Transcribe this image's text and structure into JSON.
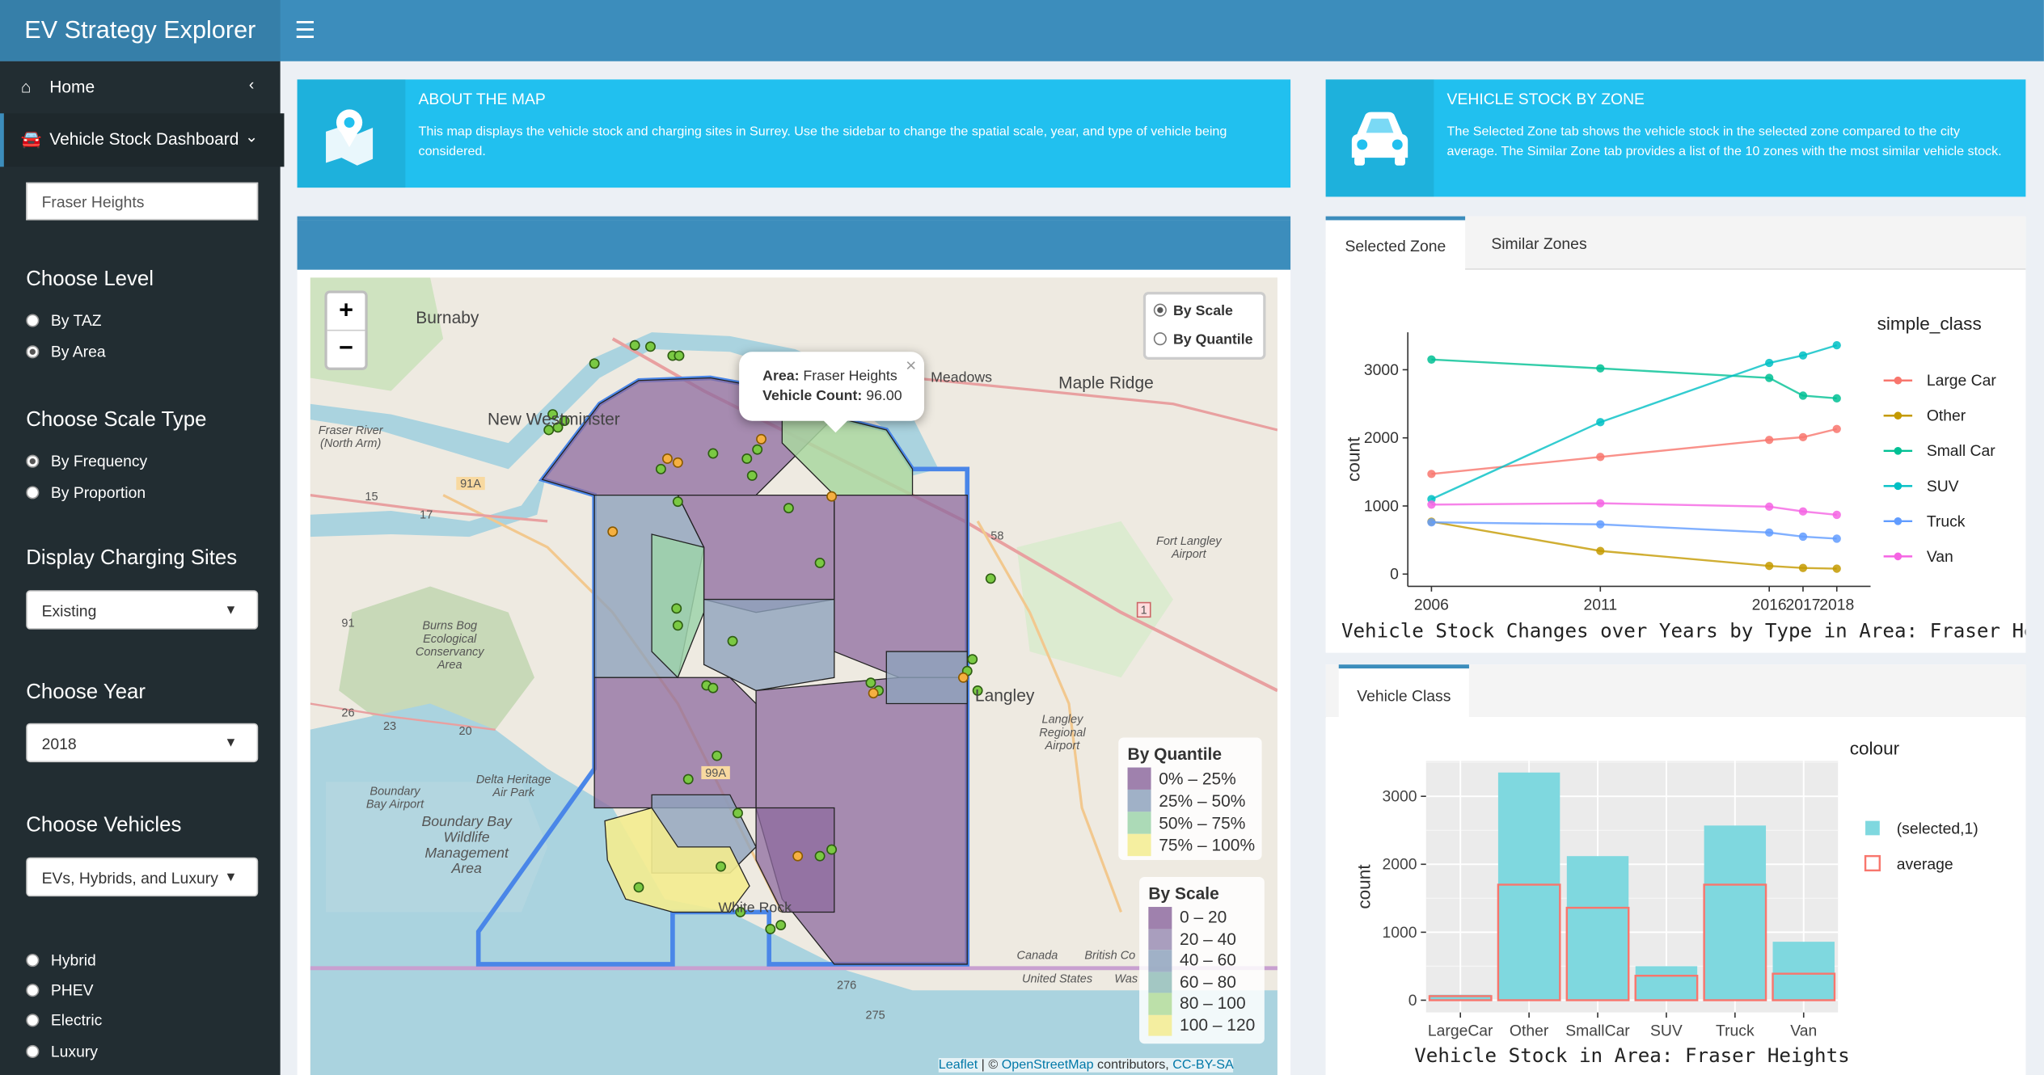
{
  "app": {
    "title": "EV Strategy Explorer"
  },
  "sidebar": {
    "menu": [
      {
        "label": "Home",
        "icon": "home-icon"
      },
      {
        "label": "Vehicle Stock Dashboard",
        "icon": "car-icon"
      }
    ],
    "area_input": "Fraser Heights",
    "level": {
      "heading": "Choose Level",
      "options": [
        "By TAZ",
        "By Area"
      ],
      "selected": "By Area"
    },
    "scale_type": {
      "heading": "Choose Scale Type",
      "options": [
        "By Frequency",
        "By Proportion"
      ],
      "selected": "By Frequency"
    },
    "charging": {
      "heading": "Display Charging Sites",
      "value": "Existing"
    },
    "year": {
      "heading": "Choose Year",
      "value": "2018"
    },
    "vehicles": {
      "heading": "Choose Vehicles",
      "value": "EVs, Hybrids, and Luxury",
      "options": [
        "Hybrid",
        "PHEV",
        "Electric",
        "Luxury"
      ]
    }
  },
  "about": {
    "title": "ABOUT THE MAP",
    "text": "This map displays the vehicle stock and charging sites in Surrey. Use the sidebar to change the spatial scale, year, and type of vehicle being considered."
  },
  "stock_info": {
    "title": "VEHICLE STOCK BY ZONE",
    "text": "The Selected Zone tab shows the vehicle stock in the selected zone compared to the city average. The Similar Zone tab provides a list of the 10 zones with the most similar vehicle stock."
  },
  "map": {
    "zoom_in": "+",
    "zoom_out": "−",
    "scale_options": [
      "By Scale",
      "By Quantile"
    ],
    "scale_selected": "By Scale",
    "popup": {
      "area_label": "Area:",
      "area_value": "Fraser Heights",
      "count_label": "Vehicle Count:",
      "count_value": "96.00",
      "close": "×"
    },
    "place_labels": [
      "Burnaby",
      "New Westminster",
      "Maple Ridge",
      "Meadows",
      "Langley",
      "White Rock",
      "Fort Langley Airport",
      "Burns Bog Ecological Conservancy Area",
      "Boundary Bay Wildlife Management Area",
      "Delta Heritage Air Park",
      "Boundary Bay Airport",
      "Langley Regional Airport",
      "Canada",
      "United States",
      "British Co",
      "Was",
      "Fraser River (North Arm)"
    ],
    "road_labels": [
      "91A",
      "99A",
      "15",
      "17",
      "91",
      "1",
      "58",
      "276",
      "275",
      "20",
      "23",
      "26"
    ],
    "legend_quantile": {
      "title": "By Quantile",
      "items": [
        "0% – 25%",
        "25% – 50%",
        "50% – 75%",
        "75% – 100%"
      ],
      "colors": [
        "#8e6b9f",
        "#8fa3bd",
        "#9dd3aa",
        "#f3ec8f"
      ]
    },
    "legend_scale": {
      "title": "By Scale",
      "items": [
        "0 – 20",
        "20 – 40",
        "40 – 60",
        "60 – 80",
        "80 – 100",
        "100 – 120"
      ],
      "colors": [
        "#8e6b9f",
        "#9a8db3",
        "#8fa3bd",
        "#93bdb8",
        "#b3dc9a",
        "#f5ec8f"
      ]
    },
    "attribution": {
      "leaflet": "Leaflet",
      "sep": " | © ",
      "osm": "OpenStreetMap",
      "mid": " contributors, ",
      "license": "CC-BY-SA"
    }
  },
  "tabs_top": {
    "items": [
      "Selected Zone",
      "Similar Zones"
    ],
    "active": "Selected Zone"
  },
  "tabs_bottom": {
    "items": [
      "Vehicle Class"
    ],
    "active": "Vehicle Class"
  },
  "line_chart": {
    "chart_data": {
      "type": "line",
      "title": "Vehicle Stock Changes over Years by Type in Area: Fraser Heights",
      "xlabel": "",
      "ylabel": "count",
      "legend_title": "simple_class",
      "x": [
        2006,
        2011,
        2016,
        2017,
        2018
      ],
      "x_tick_labels": [
        "2006",
        "2011",
        "2016",
        "2017",
        "2018"
      ],
      "ylim": [
        0,
        3500
      ],
      "y_ticks": [
        0,
        1000,
        2000,
        3000
      ],
      "series": [
        {
          "name": "Large Car",
          "color": "#f8766d",
          "values": [
            1470,
            1720,
            1970,
            2010,
            2130
          ]
        },
        {
          "name": "Other",
          "color": "#c49a00",
          "values": [
            770,
            340,
            120,
            90,
            80
          ]
        },
        {
          "name": "Small Car",
          "color": "#53b400",
          "values": [
            3150,
            3020,
            2880,
            2620,
            2580
          ]
        },
        {
          "name": "SUV",
          "color": "#00c094",
          "values": [
            1100,
            2230,
            3100,
            3210,
            3360
          ]
        },
        {
          "name": "Truck",
          "color": "#00b6eb",
          "values": [
            760,
            730,
            610,
            550,
            520
          ]
        },
        {
          "name": "Van",
          "color": "#fb61d7",
          "values": [
            1020,
            1040,
            990,
            920,
            870
          ]
        }
      ],
      "line_colors": [
        "#f8766d",
        "#c49a00",
        "#00c094",
        "#00bfc4",
        "#619cff",
        "#f564e3"
      ]
    }
  },
  "bar_chart": {
    "chart_data": {
      "type": "bar",
      "title": "Vehicle Stock in Area: Fraser Heights",
      "xlabel": "",
      "ylabel": "count",
      "legend_title": "colour",
      "categories": [
        "LargeCar",
        "Other",
        "SmallCar",
        "SUV",
        "Truck",
        "Van"
      ],
      "ylim": [
        0,
        3500
      ],
      "y_ticks": [
        0,
        1000,
        2000,
        3000
      ],
      "series": [
        {
          "name": "(selected,1)",
          "color": "#7fd8df",
          "values": [
            80,
            3350,
            2120,
            500,
            2570,
            860
          ]
        },
        {
          "name": "average",
          "color": "#f8766d",
          "values": [
            60,
            1700,
            1360,
            360,
            1700,
            390
          ]
        }
      ]
    }
  }
}
